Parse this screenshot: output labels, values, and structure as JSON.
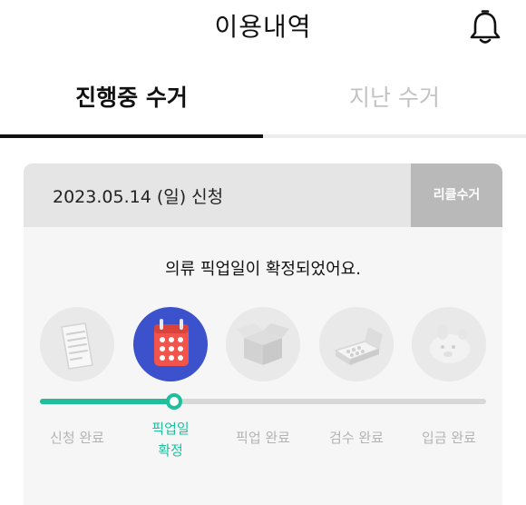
{
  "header": {
    "title": "이용내역",
    "icon": "bell-icon"
  },
  "tabs": [
    {
      "label": "진행중 수거",
      "active": true
    },
    {
      "label": "지난 수거",
      "active": false
    }
  ],
  "order": {
    "date_label": "2023.05.14 (일) 신청",
    "action_label": "리클수거",
    "status_message": "의류 픽업일이 확정되었어요.",
    "steps": [
      {
        "label": "신청 완료",
        "icon": "receipt-icon",
        "active": false
      },
      {
        "label": "픽업일",
        "label2": "확정",
        "icon": "calendar-icon",
        "active": true
      },
      {
        "label": "픽업 완료",
        "icon": "box-icon",
        "active": false
      },
      {
        "label": "검수 완료",
        "icon": "scale-icon",
        "active": false
      },
      {
        "label": "입금 완료",
        "icon": "piggy-bank-icon",
        "active": false
      }
    ],
    "progress_fraction": 0.3
  },
  "colors": {
    "accent": "#1fbf9c",
    "active_step_bg": "#3b52cc",
    "calendar": "#f2534a"
  }
}
